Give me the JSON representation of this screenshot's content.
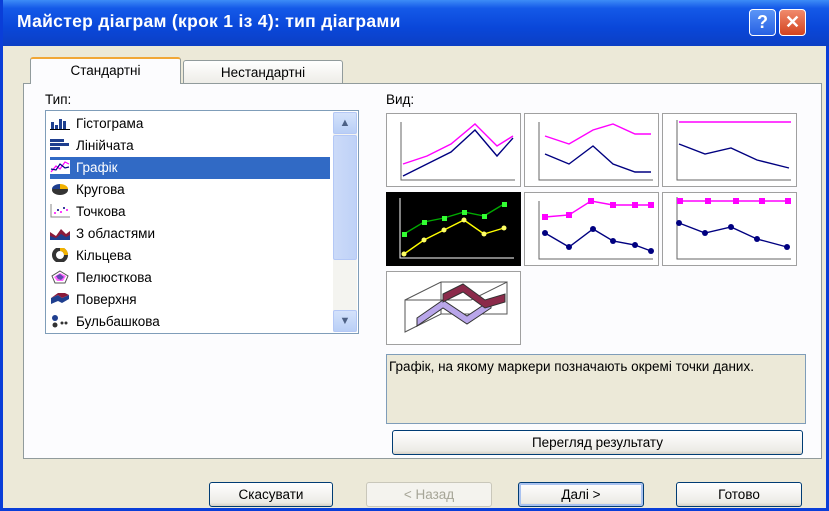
{
  "window": {
    "title": "Майстер діаграм (крок 1 із 4): тип діаграми",
    "help_glyph": "?",
    "close_glyph": "✕"
  },
  "tabs": [
    {
      "label": "Стандартні",
      "active": true
    },
    {
      "label": "Нестандартні",
      "active": false
    }
  ],
  "type_label": "Тип:",
  "view_label": "Вид:",
  "chart_types": [
    {
      "label": "Гістограма",
      "icon": "column-chart-icon"
    },
    {
      "label": "Лінійчата",
      "icon": "bar-chart-icon"
    },
    {
      "label": "Графік",
      "icon": "line-chart-icon",
      "selected": true
    },
    {
      "label": "Кругова",
      "icon": "pie-chart-icon"
    },
    {
      "label": "Точкова",
      "icon": "scatter-chart-icon"
    },
    {
      "label": "З областями",
      "icon": "area-chart-icon"
    },
    {
      "label": "Кільцева",
      "icon": "doughnut-chart-icon"
    },
    {
      "label": "Пелюсткова",
      "icon": "radar-chart-icon"
    },
    {
      "label": "Поверхня",
      "icon": "surface-chart-icon"
    },
    {
      "label": "Бульбашкова",
      "icon": "bubble-chart-icon"
    }
  ],
  "subtypes_selected_index": 3,
  "description": "Графік, на якому маркери позначають окремі точки даних.",
  "preview_button": "Перегляд результату",
  "buttons": {
    "cancel": "Скасувати",
    "back": "< Назад",
    "next": "Далі >",
    "finish": "Готово"
  },
  "colors": {
    "titlebar": "#0a47d9",
    "selection": "#316ac5",
    "series1": "#ff00ff",
    "series2": "#000080"
  }
}
